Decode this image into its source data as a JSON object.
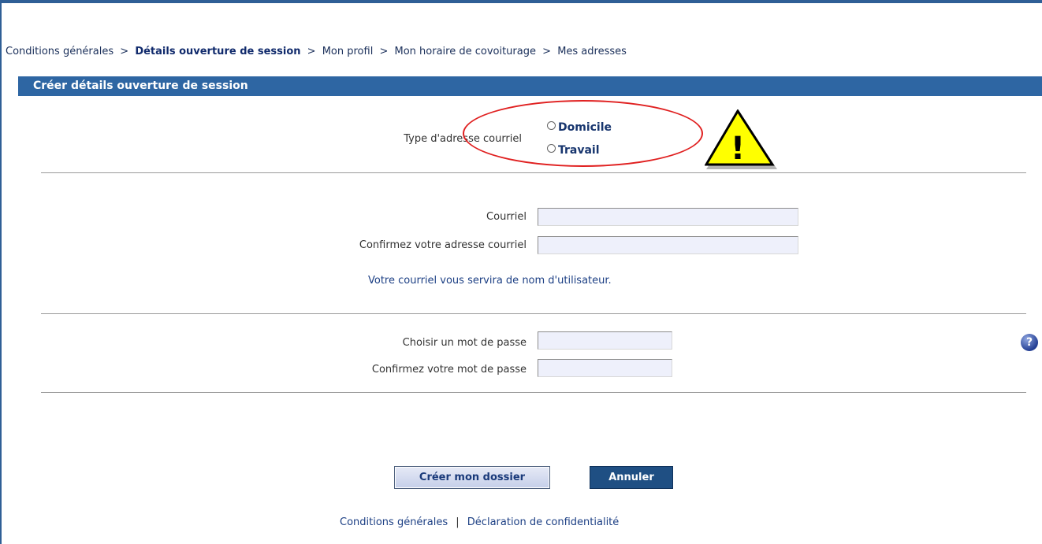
{
  "breadcrumb": {
    "items": [
      "Conditions générales",
      "Détails ouverture de session",
      "Mon profil",
      "Mon horaire de covoiturage",
      "Mes adresses"
    ],
    "separator": ">"
  },
  "section": {
    "title": "Créer détails ouverture de session"
  },
  "email_type": {
    "label": "Type d'adresse courriel",
    "options": [
      "Domicile",
      "Travail"
    ]
  },
  "warning_icon": {
    "icon": "warning-triangle-icon",
    "glyph": "!"
  },
  "email": {
    "label": "Courriel",
    "value": "",
    "confirm_label": "Confirmez votre adresse courriel",
    "confirm_value": "",
    "info": "Votre courriel vous servira de nom d'utilisateur."
  },
  "password": {
    "label": "Choisir un mot de passe",
    "value": "",
    "confirm_label": "Confirmez votre mot de passe",
    "confirm_value": ""
  },
  "help": {
    "icon": "help-icon",
    "glyph": "?"
  },
  "buttons": {
    "create": "Créer mon dossier",
    "cancel": "Annuler"
  },
  "footer": {
    "links": [
      "Conditions générales",
      "Déclaration de confidentialité"
    ],
    "separator": "|"
  },
  "colors": {
    "accent": "#2e66a3",
    "link": "#1c3f84",
    "highlight_ellipse": "#e02020",
    "warning_fill": "#ffff00",
    "field_bg": "#eef0fb"
  }
}
